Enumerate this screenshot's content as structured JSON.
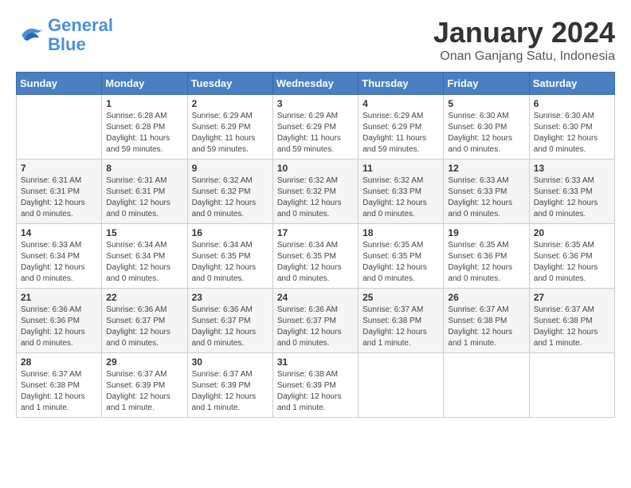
{
  "logo": {
    "line1": "General",
    "line2": "Blue"
  },
  "title": "January 2024",
  "subtitle": "Onan Ganjang Satu, Indonesia",
  "headers": [
    "Sunday",
    "Monday",
    "Tuesday",
    "Wednesday",
    "Thursday",
    "Friday",
    "Saturday"
  ],
  "weeks": [
    [
      {
        "day": "",
        "content": ""
      },
      {
        "day": "1",
        "content": "Sunrise: 6:28 AM\nSunset: 6:28 PM\nDaylight: 11 hours and 59 minutes."
      },
      {
        "day": "2",
        "content": "Sunrise: 6:29 AM\nSunset: 6:29 PM\nDaylight: 11 hours and 59 minutes."
      },
      {
        "day": "3",
        "content": "Sunrise: 6:29 AM\nSunset: 6:29 PM\nDaylight: 11 hours and 59 minutes."
      },
      {
        "day": "4",
        "content": "Sunrise: 6:29 AM\nSunset: 6:29 PM\nDaylight: 11 hours and 59 minutes."
      },
      {
        "day": "5",
        "content": "Sunrise: 6:30 AM\nSunset: 6:30 PM\nDaylight: 12 hours and 0 minutes."
      },
      {
        "day": "6",
        "content": "Sunrise: 6:30 AM\nSunset: 6:30 PM\nDaylight: 12 hours and 0 minutes."
      }
    ],
    [
      {
        "day": "7",
        "content": "Sunrise: 6:31 AM\nSunset: 6:31 PM\nDaylight: 12 hours and 0 minutes."
      },
      {
        "day": "8",
        "content": "Sunrise: 6:31 AM\nSunset: 6:31 PM\nDaylight: 12 hours and 0 minutes."
      },
      {
        "day": "9",
        "content": "Sunrise: 6:32 AM\nSunset: 6:32 PM\nDaylight: 12 hours and 0 minutes."
      },
      {
        "day": "10",
        "content": "Sunrise: 6:32 AM\nSunset: 6:32 PM\nDaylight: 12 hours and 0 minutes."
      },
      {
        "day": "11",
        "content": "Sunrise: 6:32 AM\nSunset: 6:33 PM\nDaylight: 12 hours and 0 minutes."
      },
      {
        "day": "12",
        "content": "Sunrise: 6:33 AM\nSunset: 6:33 PM\nDaylight: 12 hours and 0 minutes."
      },
      {
        "day": "13",
        "content": "Sunrise: 6:33 AM\nSunset: 6:33 PM\nDaylight: 12 hours and 0 minutes."
      }
    ],
    [
      {
        "day": "14",
        "content": "Sunrise: 6:33 AM\nSunset: 6:34 PM\nDaylight: 12 hours and 0 minutes."
      },
      {
        "day": "15",
        "content": "Sunrise: 6:34 AM\nSunset: 6:34 PM\nDaylight: 12 hours and 0 minutes."
      },
      {
        "day": "16",
        "content": "Sunrise: 6:34 AM\nSunset: 6:35 PM\nDaylight: 12 hours and 0 minutes."
      },
      {
        "day": "17",
        "content": "Sunrise: 6:34 AM\nSunset: 6:35 PM\nDaylight: 12 hours and 0 minutes."
      },
      {
        "day": "18",
        "content": "Sunrise: 6:35 AM\nSunset: 6:35 PM\nDaylight: 12 hours and 0 minutes."
      },
      {
        "day": "19",
        "content": "Sunrise: 6:35 AM\nSunset: 6:36 PM\nDaylight: 12 hours and 0 minutes."
      },
      {
        "day": "20",
        "content": "Sunrise: 6:35 AM\nSunset: 6:36 PM\nDaylight: 12 hours and 0 minutes."
      }
    ],
    [
      {
        "day": "21",
        "content": "Sunrise: 6:36 AM\nSunset: 6:36 PM\nDaylight: 12 hours and 0 minutes."
      },
      {
        "day": "22",
        "content": "Sunrise: 6:36 AM\nSunset: 6:37 PM\nDaylight: 12 hours and 0 minutes."
      },
      {
        "day": "23",
        "content": "Sunrise: 6:36 AM\nSunset: 6:37 PM\nDaylight: 12 hours and 0 minutes."
      },
      {
        "day": "24",
        "content": "Sunrise: 6:36 AM\nSunset: 6:37 PM\nDaylight: 12 hours and 0 minutes."
      },
      {
        "day": "25",
        "content": "Sunrise: 6:37 AM\nSunset: 6:38 PM\nDaylight: 12 hours and 1 minute."
      },
      {
        "day": "26",
        "content": "Sunrise: 6:37 AM\nSunset: 6:38 PM\nDaylight: 12 hours and 1 minute."
      },
      {
        "day": "27",
        "content": "Sunrise: 6:37 AM\nSunset: 6:38 PM\nDaylight: 12 hours and 1 minute."
      }
    ],
    [
      {
        "day": "28",
        "content": "Sunrise: 6:37 AM\nSunset: 6:38 PM\nDaylight: 12 hours and 1 minute."
      },
      {
        "day": "29",
        "content": "Sunrise: 6:37 AM\nSunset: 6:39 PM\nDaylight: 12 hours and 1 minute."
      },
      {
        "day": "30",
        "content": "Sunrise: 6:37 AM\nSunset: 6:39 PM\nDaylight: 12 hours and 1 minute."
      },
      {
        "day": "31",
        "content": "Sunrise: 6:38 AM\nSunset: 6:39 PM\nDaylight: 12 hours and 1 minute."
      },
      {
        "day": "",
        "content": ""
      },
      {
        "day": "",
        "content": ""
      },
      {
        "day": "",
        "content": ""
      }
    ]
  ]
}
